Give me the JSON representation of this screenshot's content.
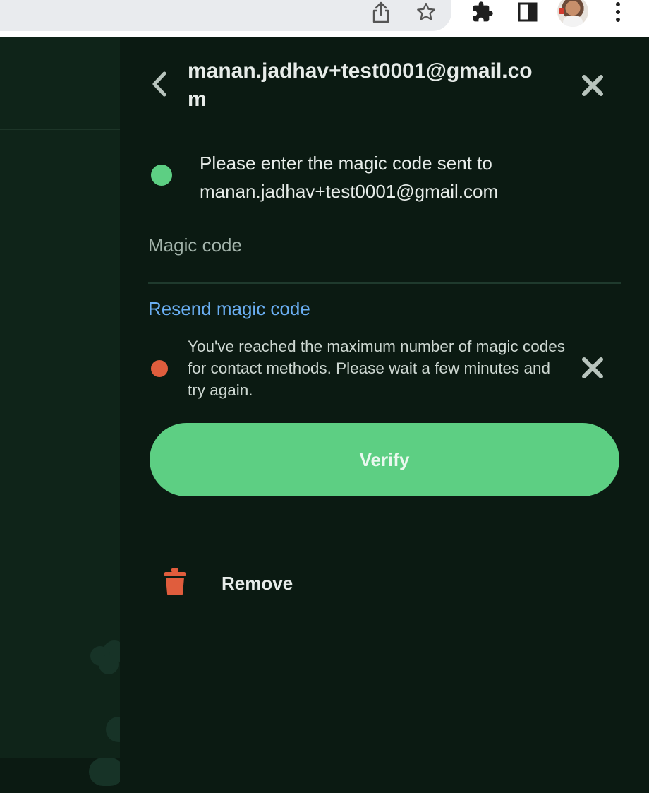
{
  "browser": {
    "icons": [
      "share-icon",
      "bookmark-star-icon",
      "extensions-icon",
      "side-panel-icon",
      "profile-avatar",
      "more-menu-icon"
    ]
  },
  "panel": {
    "title": "manan.jadhav+test0001@gmail.com",
    "info_message": "Please enter the magic code sent to manan.jadhav+test0001@gmail.com",
    "magic_code": {
      "placeholder": "Magic code",
      "value": ""
    },
    "resend_label": "Resend magic code",
    "error_message": "You've reached the maximum number of magic codes for contact methods. Please wait a few minutes and try again.",
    "verify_label": "Verify",
    "remove_label": "Remove"
  },
  "colors": {
    "background": "#0b1a12",
    "accent_green": "#5dcf83",
    "link_blue": "#6aaef2",
    "error_red": "#e05d3d",
    "text_primary": "#e7ece9"
  }
}
